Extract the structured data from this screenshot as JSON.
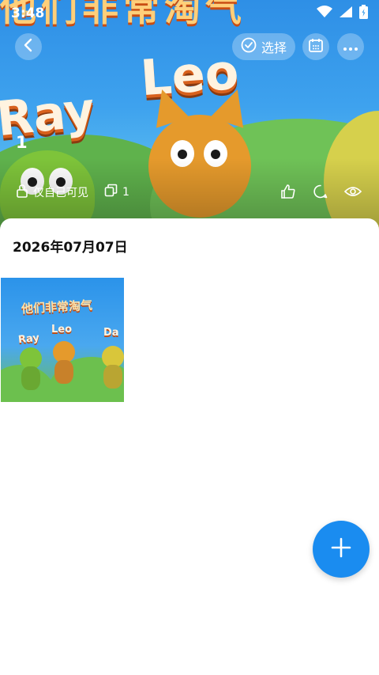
{
  "status": {
    "time": "3:48"
  },
  "header": {
    "select_label": "选择",
    "album_count": "1",
    "visibility_label": "仅自己可见",
    "copy_count": "1"
  },
  "content": {
    "date_heading": "2026年07月07日"
  },
  "colors": {
    "accent": "#1a8cf0",
    "sheet": "#ffffff"
  },
  "icons": {
    "back": "chevron-left-icon",
    "select": "check-circle-icon",
    "calendar": "calendar-icon",
    "more": "more-icon",
    "lock": "lock-icon",
    "copy": "copy-icon",
    "like": "thumbs-up-icon",
    "comment": "comment-icon",
    "views": "eye-icon",
    "add": "plus-icon"
  }
}
